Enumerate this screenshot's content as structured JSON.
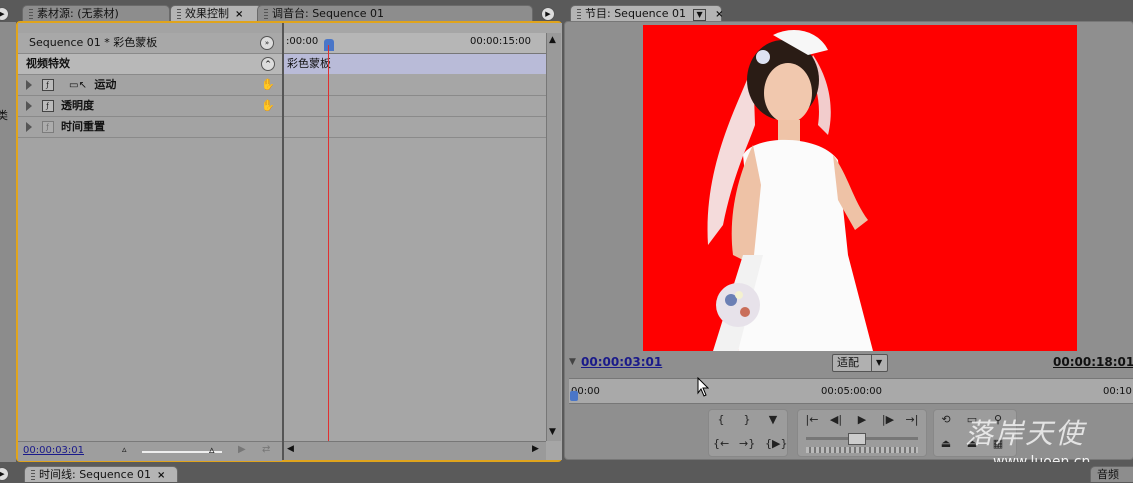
{
  "left_tabs": {
    "source": "素材源: (无素材)",
    "effects": "效果控制",
    "mixer": "调音台: Sequence 01"
  },
  "effects_panel": {
    "clip_title": "Sequence 01 * 彩色蒙板",
    "section_header": "视频特效",
    "effects": [
      {
        "label": "运动"
      },
      {
        "label": "透明度"
      },
      {
        "label": "时间重置"
      }
    ],
    "ruler_start": ":00:00",
    "ruler_end": "00:00:15:00",
    "clip_bar_label": "彩色蒙板",
    "current_time": "00:00:03:01"
  },
  "program_panel": {
    "tab": "节目: Sequence 01",
    "current_time": "00:00:03:01",
    "fit_label": "适配",
    "duration": "00:00:18:01",
    "ruler_labels": [
      "00:00",
      "00:05:00:00",
      "00:10"
    ],
    "background_color": "#ff0000"
  },
  "timeline_tab": "时间线: Sequence 01",
  "right_bottom_tab": "音频",
  "left_edge_label": "类",
  "watermark": {
    "title": "落岸天使",
    "url": "www.luoen.cn"
  },
  "icons": {
    "panel_menu": "play-circle-icon",
    "close": "close-icon",
    "expand": "triangle-right-icon",
    "reset": "reset-hand-icon"
  },
  "colors": {
    "accent_border": "#e0a41c",
    "playhead": "#e03030",
    "clip_bar": "#b9bbd8"
  }
}
